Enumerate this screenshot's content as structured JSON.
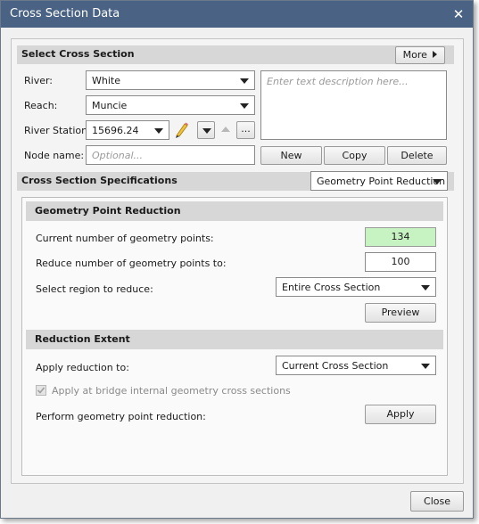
{
  "window": {
    "title": "Cross Section Data",
    "close_glyph": "✕",
    "close_button": "Close"
  },
  "select": {
    "header": "Select Cross Section",
    "more_button": "More",
    "river_label": "River:",
    "river_value": "White",
    "reach_label": "Reach:",
    "reach_value": "Muncie",
    "station_label": "River Station:",
    "station_value": "15696.24",
    "node_label": "Node name:",
    "node_placeholder": "Optional...",
    "description_placeholder": "Enter text description here...",
    "ellipsis_button": "...",
    "new_button": "New",
    "copy_button": "Copy",
    "delete_button": "Delete"
  },
  "specs": {
    "header": "Cross Section Specifications",
    "dropdown_value": "Geometry Point Reduction"
  },
  "gpr": {
    "header": "Geometry Point Reduction",
    "current_label": "Current number of geometry points:",
    "current_value": "134",
    "reduce_label": "Reduce number of geometry points to:",
    "reduce_value": "100",
    "region_label": "Select region to reduce:",
    "region_value": "Entire Cross Section",
    "preview_button": "Preview"
  },
  "extent": {
    "header": "Reduction Extent",
    "apply_to_label": "Apply reduction to:",
    "apply_to_value": "Current Cross Section",
    "bridge_checkbox_label": "Apply at bridge internal geometry cross sections",
    "bridge_checked": true,
    "perform_label": "Perform geometry point reduction:",
    "apply_button": "Apply"
  },
  "colors": {
    "titlebar": "#4a6384",
    "current_points_bg": "#c7f2c2"
  }
}
